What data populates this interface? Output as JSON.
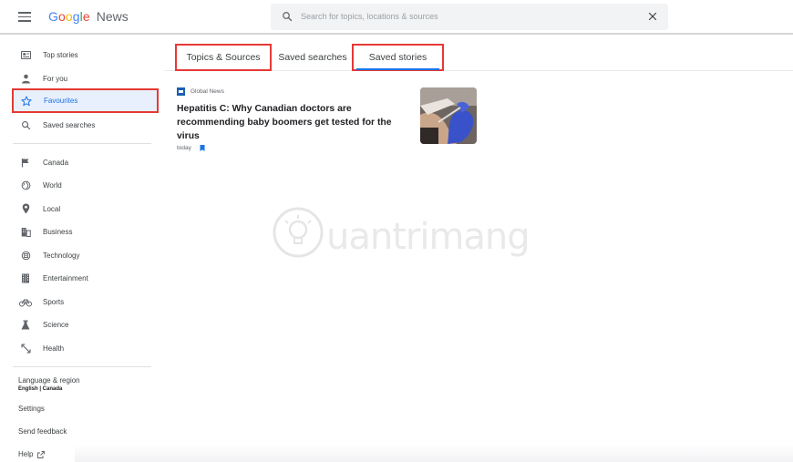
{
  "header": {
    "logo": {
      "letters": [
        "G",
        "o",
        "o",
        "g",
        "l",
        "e"
      ],
      "product": "News"
    },
    "search": {
      "placeholder": "Search for topics, locations & sources",
      "value": ""
    },
    "icons": {
      "menu": "menu-icon",
      "search": "search-icon",
      "clear": "close-icon"
    }
  },
  "sidebar": {
    "primary": [
      {
        "label": "Top stories",
        "icon": "top-stories-icon"
      },
      {
        "label": "For you",
        "icon": "person-icon"
      },
      {
        "label": "Favourites",
        "icon": "star-icon"
      },
      {
        "label": "Saved searches",
        "icon": "search-icon"
      }
    ],
    "sections": [
      {
        "label": "Canada",
        "icon": "flag-icon"
      },
      {
        "label": "World",
        "icon": "globe-icon"
      },
      {
        "label": "Local",
        "icon": "location-pin-icon"
      },
      {
        "label": "Business",
        "icon": "business-icon"
      },
      {
        "label": "Technology",
        "icon": "technology-icon"
      },
      {
        "label": "Entertainment",
        "icon": "film-icon"
      },
      {
        "label": "Sports",
        "icon": "bike-icon"
      },
      {
        "label": "Science",
        "icon": "flask-icon"
      },
      {
        "label": "Health",
        "icon": "health-icon"
      }
    ],
    "footer": {
      "language_region": "Language & region",
      "language_value": "English | Canada",
      "settings": "Settings",
      "feedback": "Send feedback",
      "help": "Help"
    }
  },
  "tabs": [
    {
      "label": "Topics & Sources"
    },
    {
      "label": "Saved searches"
    },
    {
      "label": "Saved stories"
    }
  ],
  "article": {
    "source": "Global News",
    "headline": "Hepatitis C: Why Canadian doctors are recommending baby boomers get tested for the virus",
    "time": "today"
  },
  "watermark": {
    "text": "uantrimang"
  },
  "colors": {
    "accent": "#1a73e8",
    "highlight_box": "#e53935",
    "logo_blue": "#4285f4",
    "logo_red": "#ea4335",
    "logo_yellow": "#fbbc05",
    "logo_green": "#34a853"
  }
}
